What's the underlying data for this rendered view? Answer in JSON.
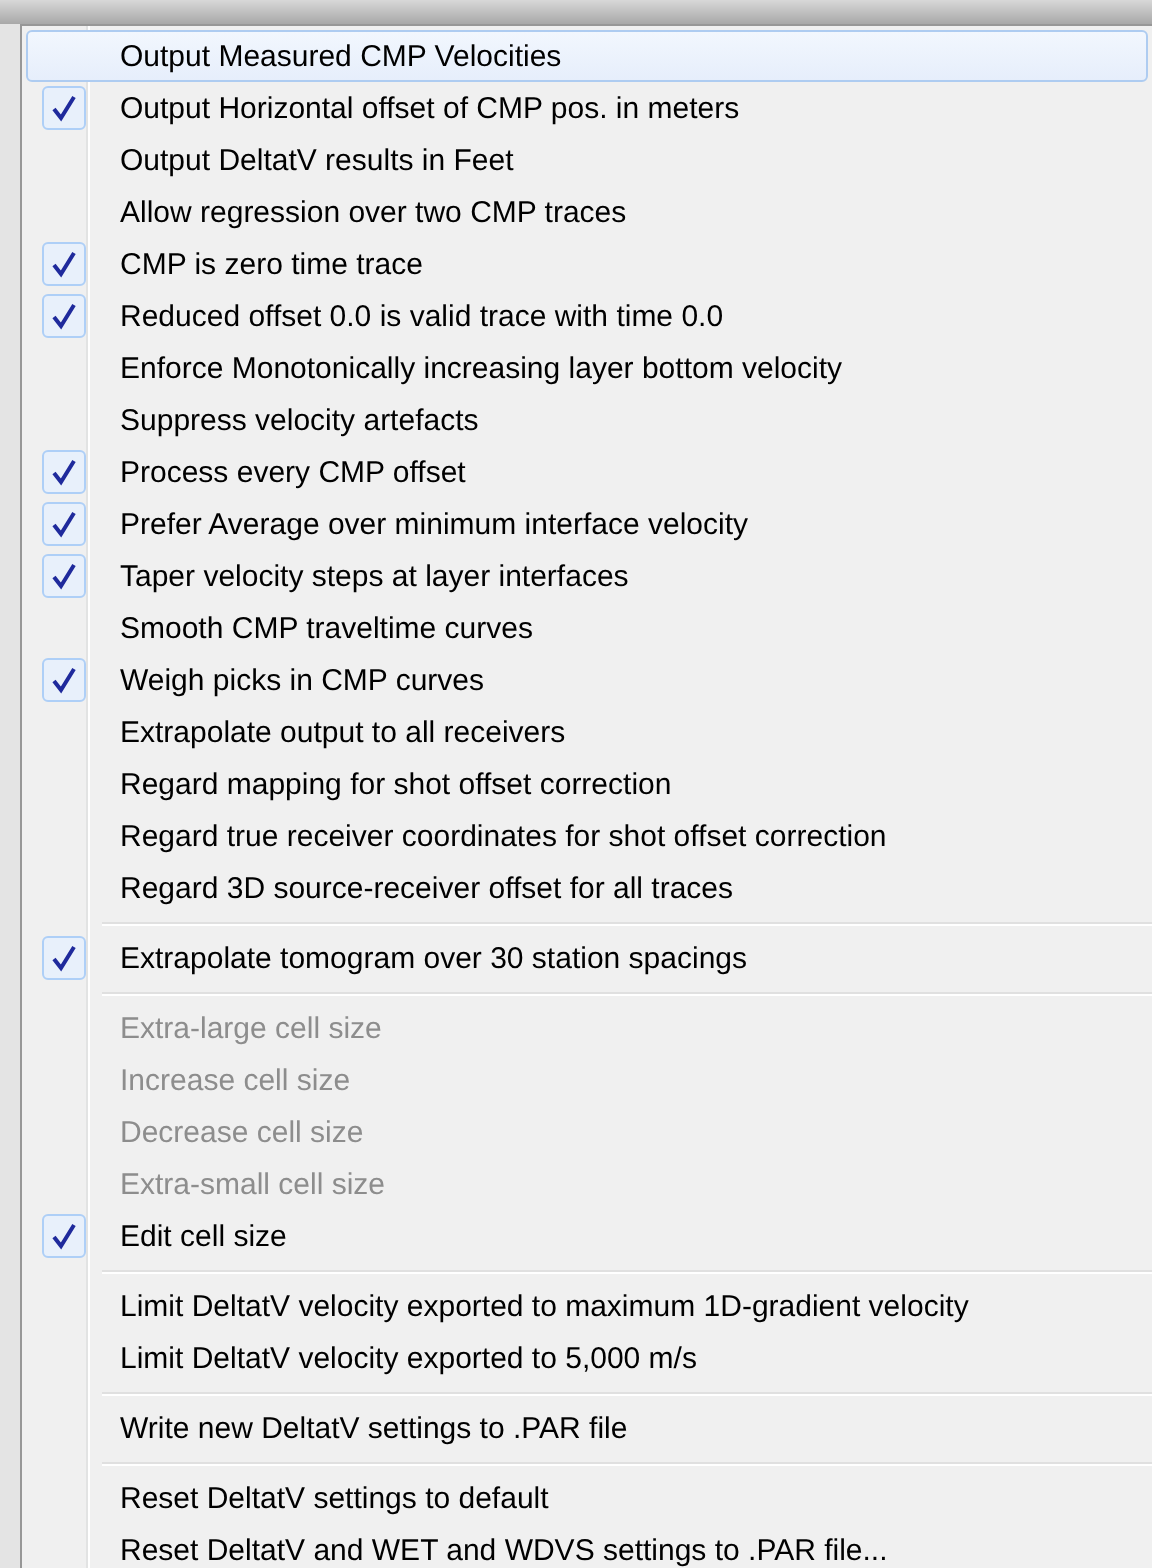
{
  "menu": {
    "groups": [
      {
        "items": [
          {
            "label": "Output Measured CMP Velocities",
            "checked": false,
            "disabled": false,
            "selected": true
          },
          {
            "label": "Output Horizontal offset of CMP pos. in meters",
            "checked": true,
            "disabled": false,
            "selected": false
          },
          {
            "label": "Output DeltatV results in Feet",
            "checked": false,
            "disabled": false,
            "selected": false
          },
          {
            "label": "Allow regression over two CMP traces",
            "checked": false,
            "disabled": false,
            "selected": false
          },
          {
            "label": "CMP is zero time trace",
            "checked": true,
            "disabled": false,
            "selected": false
          },
          {
            "label": "Reduced offset 0.0 is valid trace with time 0.0",
            "checked": true,
            "disabled": false,
            "selected": false
          },
          {
            "label": "Enforce Monotonically increasing layer bottom velocity",
            "checked": false,
            "disabled": false,
            "selected": false
          },
          {
            "label": "Suppress velocity artefacts",
            "checked": false,
            "disabled": false,
            "selected": false
          },
          {
            "label": "Process every CMP offset",
            "checked": true,
            "disabled": false,
            "selected": false
          },
          {
            "label": "Prefer Average over minimum interface velocity",
            "checked": true,
            "disabled": false,
            "selected": false
          },
          {
            "label": "Taper velocity steps at layer interfaces",
            "checked": true,
            "disabled": false,
            "selected": false
          },
          {
            "label": "Smooth CMP traveltime curves",
            "checked": false,
            "disabled": false,
            "selected": false
          },
          {
            "label": "Weigh picks in CMP curves",
            "checked": true,
            "disabled": false,
            "selected": false
          },
          {
            "label": "Extrapolate output to all receivers",
            "checked": false,
            "disabled": false,
            "selected": false
          },
          {
            "label": "Regard mapping for shot offset correction",
            "checked": false,
            "disabled": false,
            "selected": false
          },
          {
            "label": "Regard true receiver coordinates for shot offset correction",
            "checked": false,
            "disabled": false,
            "selected": false
          },
          {
            "label": "Regard 3D source-receiver offset for all traces",
            "checked": false,
            "disabled": false,
            "selected": false
          }
        ]
      },
      {
        "items": [
          {
            "label": "Extrapolate tomogram over 30 station spacings",
            "checked": true,
            "disabled": false,
            "selected": false
          }
        ]
      },
      {
        "items": [
          {
            "label": "Extra-large cell size",
            "checked": false,
            "disabled": true,
            "selected": false
          },
          {
            "label": "Increase cell size",
            "checked": false,
            "disabled": true,
            "selected": false
          },
          {
            "label": "Decrease cell size",
            "checked": false,
            "disabled": true,
            "selected": false
          },
          {
            "label": "Extra-small cell size",
            "checked": false,
            "disabled": true,
            "selected": false
          },
          {
            "label": "Edit cell size",
            "checked": true,
            "disabled": false,
            "selected": false
          }
        ]
      },
      {
        "items": [
          {
            "label": "Limit DeltatV velocity exported to maximum 1D-gradient velocity",
            "checked": false,
            "disabled": false,
            "selected": false
          },
          {
            "label": "Limit DeltatV velocity exported to 5,000 m/s",
            "checked": false,
            "disabled": false,
            "selected": false
          }
        ]
      },
      {
        "items": [
          {
            "label": "Write new DeltatV settings to .PAR file",
            "checked": false,
            "disabled": false,
            "selected": false
          }
        ]
      },
      {
        "items": [
          {
            "label": "Reset DeltatV settings to default",
            "checked": false,
            "disabled": false,
            "selected": false
          },
          {
            "label": "Reset DeltatV and WET and WDVS settings to .PAR file...",
            "checked": false,
            "disabled": false,
            "selected": false
          }
        ]
      }
    ]
  }
}
